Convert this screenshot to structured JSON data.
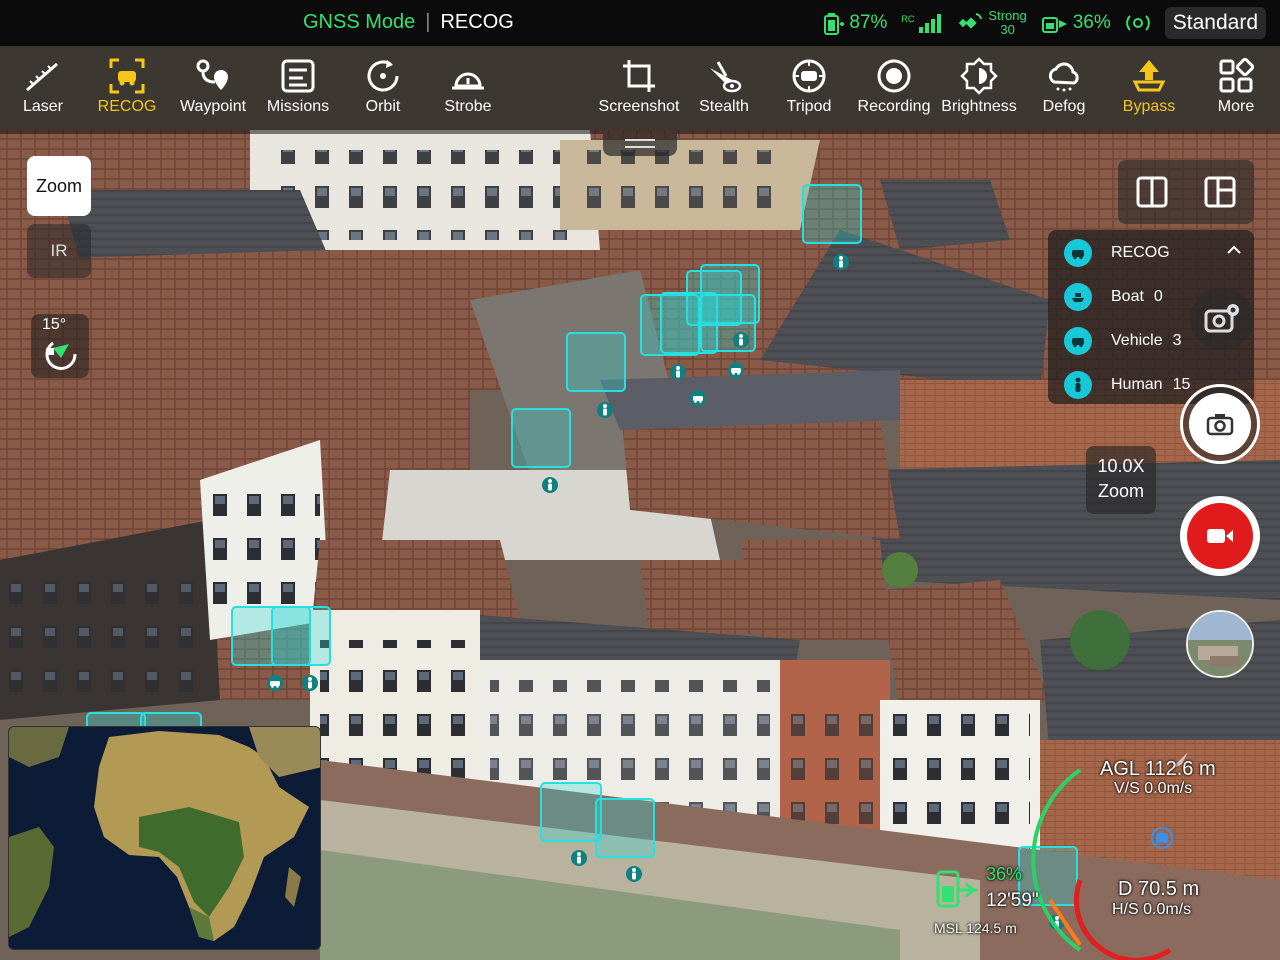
{
  "status_bar": {
    "mode": "GNSS Mode",
    "app": "RECOG",
    "aircraft_battery": "87%",
    "rc_label": "RC",
    "signal_label": "Strong",
    "signal_value": "30",
    "rc_battery": "36%",
    "profile": "Standard",
    "colors": {
      "accent_green": "#33e070"
    }
  },
  "toolbar": {
    "items": [
      {
        "label": "Laser",
        "icon": "laser-icon"
      },
      {
        "label": "RECOG",
        "icon": "recog-car-icon",
        "active": true
      },
      {
        "label": "Waypoint",
        "icon": "waypoint-icon"
      },
      {
        "label": "Missions",
        "icon": "missions-icon"
      },
      {
        "label": "Orbit",
        "icon": "orbit-icon"
      },
      {
        "label": "Strobe",
        "icon": "strobe-icon"
      },
      {
        "label": "Screenshot",
        "icon": "crop-icon"
      },
      {
        "label": "Stealth",
        "icon": "stealth-icon"
      },
      {
        "label": "Tripod",
        "icon": "tripod-icon"
      },
      {
        "label": "Recording",
        "icon": "record-icon"
      },
      {
        "label": "Brightness",
        "icon": "brightness-icon"
      },
      {
        "label": "Defog",
        "icon": "defog-icon"
      },
      {
        "label": "Bypass",
        "icon": "bypass-icon",
        "active": true
      },
      {
        "label": "More",
        "icon": "grid-icon"
      }
    ],
    "active_color": "#f5c518"
  },
  "left_controls": {
    "zoom_label": "Zoom",
    "ir_label": "IR",
    "gimbal_angle": "15°"
  },
  "recog_panel": {
    "title": "RECOG",
    "rows": [
      {
        "label": "Boat",
        "count": "0",
        "icon": "boat-icon"
      },
      {
        "label": "Vehicle",
        "count": "3",
        "icon": "vehicle-icon"
      },
      {
        "label": "Human",
        "count": "15",
        "icon": "human-icon"
      }
    ],
    "accent": "#18c8d8"
  },
  "camera": {
    "zoom_value": "10.0X",
    "zoom_caption": "Zoom"
  },
  "hud": {
    "agl": "AGL 112.6 m",
    "vs": "V/S 0.0m/s",
    "distance": "D 70.5 m",
    "hs": "H/S 0.0m/s",
    "msl": "MSL 124.5 m",
    "battery": "36%",
    "flight_time": "12'59\""
  }
}
